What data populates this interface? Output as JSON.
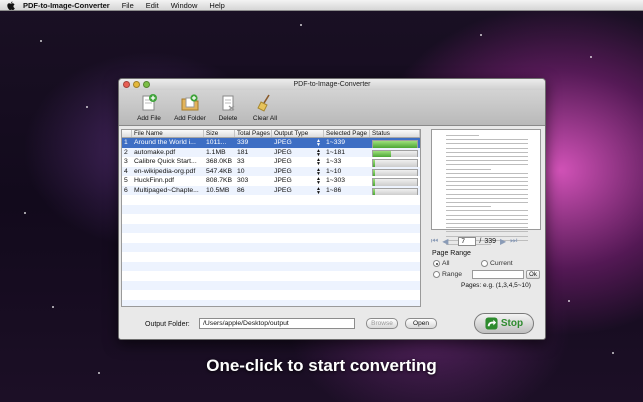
{
  "menubar": {
    "app_name": "PDF-to-Image-Converter",
    "items": [
      "File",
      "Edit",
      "Window",
      "Help"
    ]
  },
  "window": {
    "title": "PDF-to-Image-Converter"
  },
  "toolbar": {
    "add_file": "Add File",
    "add_folder": "Add Folder",
    "delete": "Delete",
    "clear_all": "Clear All"
  },
  "table": {
    "columns": [
      "File Name",
      "Size",
      "Total Pages",
      "Output Type",
      "Selected Page",
      "Status"
    ],
    "rows": [
      {
        "n": "1",
        "name": "Around the World i...",
        "size": "1011...",
        "pages": "339",
        "type": "JPEG",
        "selected": "1~339",
        "progress": 1.0
      },
      {
        "n": "2",
        "name": "automake.pdf",
        "size": "1.1MB",
        "pages": "181",
        "type": "JPEG",
        "selected": "1~181",
        "progress": 0.4
      },
      {
        "n": "3",
        "name": "Calibre Quick Start...",
        "size": "368.0KB",
        "pages": "33",
        "type": "JPEG",
        "selected": "1~33",
        "progress": 0.0
      },
      {
        "n": "4",
        "name": "en-wikipedia-org.pdf",
        "size": "547.4KB",
        "pages": "10",
        "type": "JPEG",
        "selected": "1~10",
        "progress": 0.0
      },
      {
        "n": "5",
        "name": "HuckFinn.pdf",
        "size": "808.7KB",
        "pages": "303",
        "type": "JPEG",
        "selected": "1~303",
        "progress": 0.0
      },
      {
        "n": "6",
        "name": "Multipaged~Chapte...",
        "size": "10.5MB",
        "pages": "86",
        "type": "JPEG",
        "selected": "1~86",
        "progress": 0.0
      }
    ]
  },
  "preview": {
    "current_page": "7",
    "separator": "/",
    "total_pages": "339"
  },
  "page_range": {
    "title": "Page Range",
    "all_label": "All",
    "current_label": "Current",
    "range_label": "Range",
    "ok_label": "Ok",
    "hint": "Pages: e.g. (1,3,4,5~10)",
    "selected": "All"
  },
  "output": {
    "label": "Output Folder:",
    "path": "/Users/apple/Desktop/output",
    "browse": "Browse",
    "open": "Open",
    "stop": "Stop"
  },
  "caption": "One-click to start converting",
  "colors": {
    "selection": "#3d6ec4",
    "progress": "#3f9e2a",
    "stop_text": "#2e8b2e"
  }
}
